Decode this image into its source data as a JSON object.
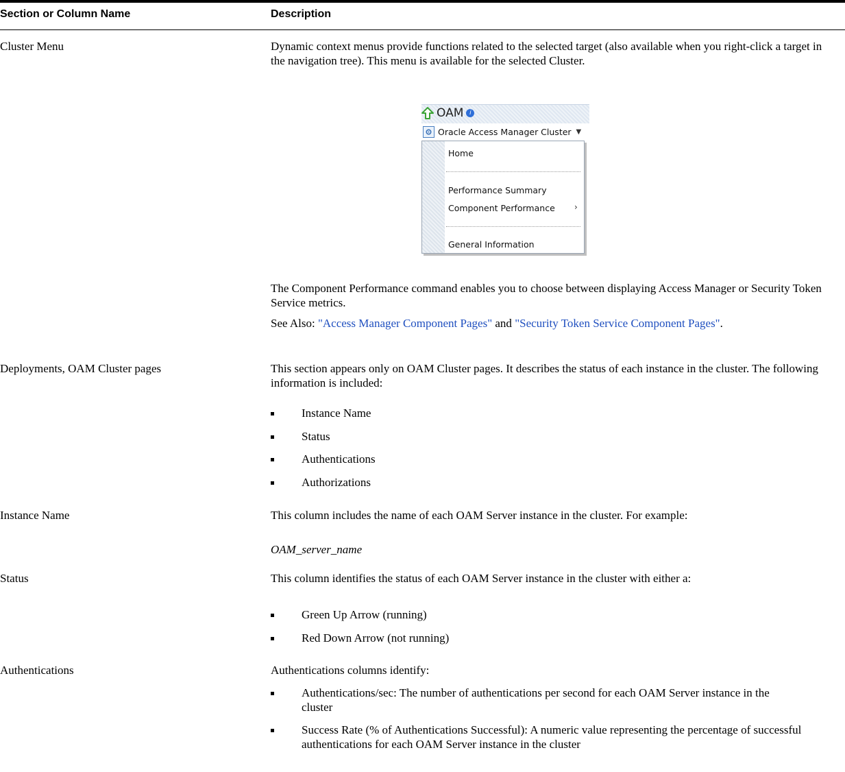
{
  "header": {
    "col1": "Section or Column Name",
    "col2": "Description"
  },
  "rows": {
    "cluster_menu": {
      "name": "Cluster Menu",
      "desc1": "Dynamic context menus provide functions related to the selected target (also available when you right-click a target in the navigation tree). This menu is available for the selected Cluster.",
      "menu": {
        "title": "OAM",
        "button_label": "Oracle Access Manager Cluster",
        "items": [
          "Home",
          "Performance Summary",
          "Component Performance",
          "General Information"
        ],
        "icons": [
          "up-arrow-icon",
          "info-icon",
          "gear-icon",
          "chevron-down-icon",
          "chevron-right-icon"
        ],
        "colors": {
          "up_arrow": "#3aa335",
          "info": "#2f6fd8"
        }
      },
      "desc2": "The Component Performance command enables you to choose between displaying Access Manager or Security Token Service metrics.",
      "see_also_prefix": "See Also: ",
      "link1": "\"Access Manager Component Pages\"",
      "and": " and ",
      "link2": "\"Security Token Service Component Pages\"",
      "end": "."
    },
    "deployments": {
      "name": "Deployments, OAM Cluster pages",
      "desc": "This section appears only on OAM Cluster pages. It describes the status of each instance in the cluster. The following information is included:",
      "bullets": [
        "Instance Name",
        "Status",
        "Authentications",
        "Authorizations"
      ]
    },
    "instance_name": {
      "name": "Instance Name",
      "desc": "This column includes the name of each OAM Server instance in the cluster. For example:",
      "example": "OAM_server_name"
    },
    "status": {
      "name": "Status",
      "desc": "This column identifies the status of each OAM Server instance in the cluster with either a:",
      "bullets": [
        "Green Up Arrow (running)",
        "Red Down Arrow (not running)"
      ]
    },
    "authentications": {
      "name": "Authentications",
      "desc": "Authentications columns identify:",
      "bullets": [
        "Authentications/sec: The number of authentications per second for each OAM Server instance in the cluster",
        "Success Rate (% of Authentications Successful): A numeric value representing the percentage of successful authentications for each OAM Server instance in the cluster"
      ]
    }
  }
}
